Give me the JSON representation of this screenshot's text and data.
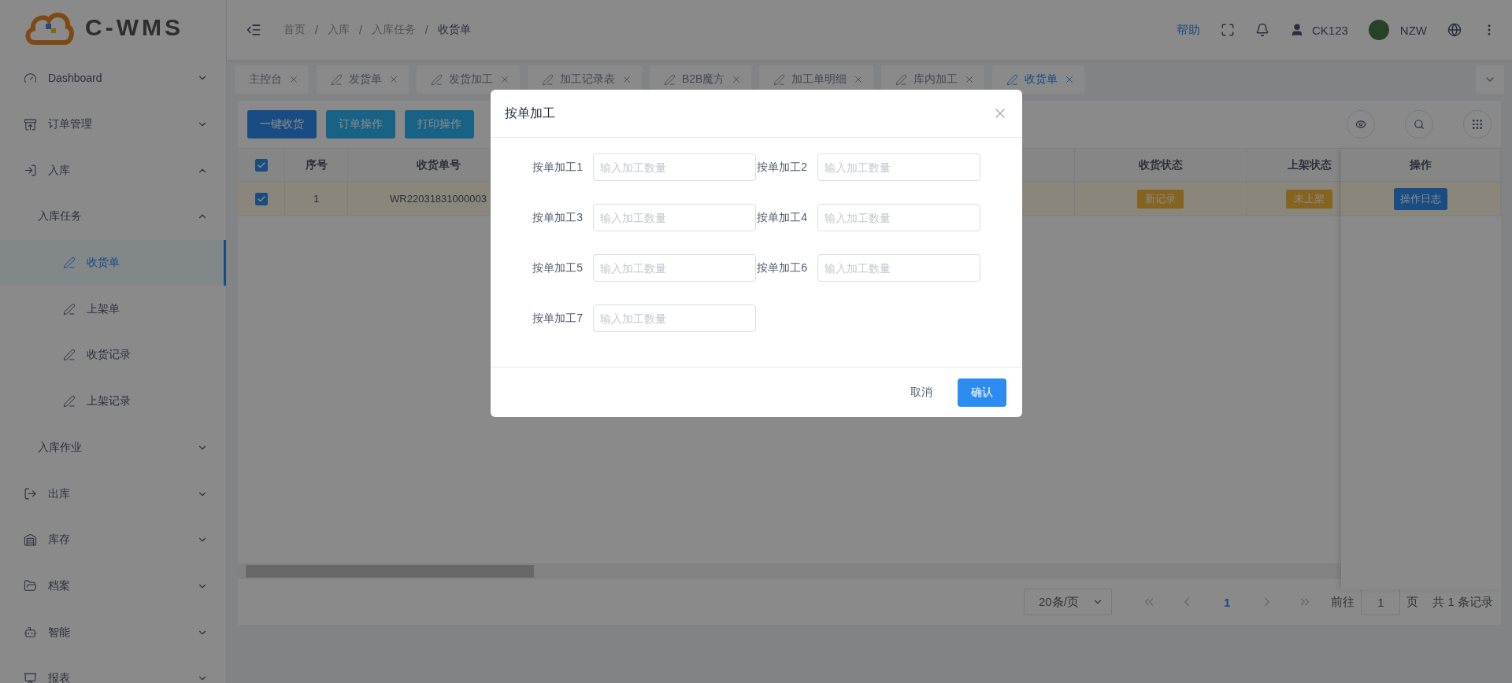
{
  "logo": {
    "text": "C-WMS"
  },
  "sidebar": {
    "items": [
      {
        "label": "Dashboard",
        "expanded": false,
        "selected": false
      },
      {
        "label": "订单管理",
        "expanded": false,
        "selected": false
      },
      {
        "label": "入库",
        "expanded": true,
        "selected": false,
        "children": [
          {
            "label": "入库任务",
            "expanded": true,
            "selected": false,
            "children": [
              {
                "label": "收货单",
                "selected": true
              },
              {
                "label": "上架单",
                "selected": false
              },
              {
                "label": "收货记录",
                "selected": false
              },
              {
                "label": "上架记录",
                "selected": false
              }
            ]
          },
          {
            "label": "入库作业",
            "expanded": false,
            "selected": false
          }
        ]
      },
      {
        "label": "出库",
        "expanded": false,
        "selected": false
      },
      {
        "label": "库存",
        "expanded": false,
        "selected": false
      },
      {
        "label": "档案",
        "expanded": false,
        "selected": false
      },
      {
        "label": "智能",
        "expanded": false,
        "selected": false
      },
      {
        "label": "报表",
        "expanded": false,
        "selected": false
      }
    ]
  },
  "header": {
    "breadcrumbs": [
      "首页",
      "入库",
      "入库任务",
      "收货单"
    ],
    "separator": "/",
    "help": "帮助",
    "user": "CK123",
    "account": "NZW"
  },
  "tabs": [
    {
      "label": "主控台",
      "kind": "home",
      "selected": false
    },
    {
      "label": "发货单",
      "kind": "page",
      "selected": false
    },
    {
      "label": "发货加工",
      "kind": "page",
      "selected": false
    },
    {
      "label": "加工记录表",
      "kind": "page",
      "selected": false
    },
    {
      "label": "B2B魔方",
      "kind": "page",
      "selected": false
    },
    {
      "label": "加工单明细",
      "kind": "page",
      "selected": false
    },
    {
      "label": "库内加工",
      "kind": "page",
      "selected": false
    },
    {
      "label": "收货单",
      "kind": "page",
      "selected": true
    }
  ],
  "toolbar": {
    "buttons": [
      "一键收货",
      "订单操作",
      "打印操作"
    ]
  },
  "table": {
    "select_all": {
      "checked": true
    },
    "columns": [
      "序号",
      "收货单号",
      "收货状态",
      "上架状态",
      "操作"
    ],
    "rows": [
      {
        "checked": true,
        "index": "1",
        "number": "WR22031831000003",
        "receive_status": "新记录",
        "shelf_status": "未上架",
        "action": "操作日志"
      }
    ]
  },
  "pagination": {
    "page_size": "20条/页",
    "pages": [
      {
        "label": "1",
        "selected": true
      }
    ],
    "goto_label": "前往",
    "goto_value": "1",
    "page_unit": "页",
    "total": "共 1 条记录"
  },
  "dialog": {
    "title": "按单加工",
    "fields": [
      {
        "label": "按单加工1",
        "placeholder": "输入加工数量"
      },
      {
        "label": "按单加工2",
        "placeholder": "输入加工数量"
      },
      {
        "label": "按单加工3",
        "placeholder": "输入加工数量"
      },
      {
        "label": "按单加工4",
        "placeholder": "输入加工数量"
      },
      {
        "label": "按单加工5",
        "placeholder": "输入加工数量"
      },
      {
        "label": "按单加工6",
        "placeholder": "输入加工数量"
      },
      {
        "label": "按单加工7",
        "placeholder": "输入加工数量"
      }
    ],
    "cancel": "取消",
    "confirm": "确认"
  }
}
